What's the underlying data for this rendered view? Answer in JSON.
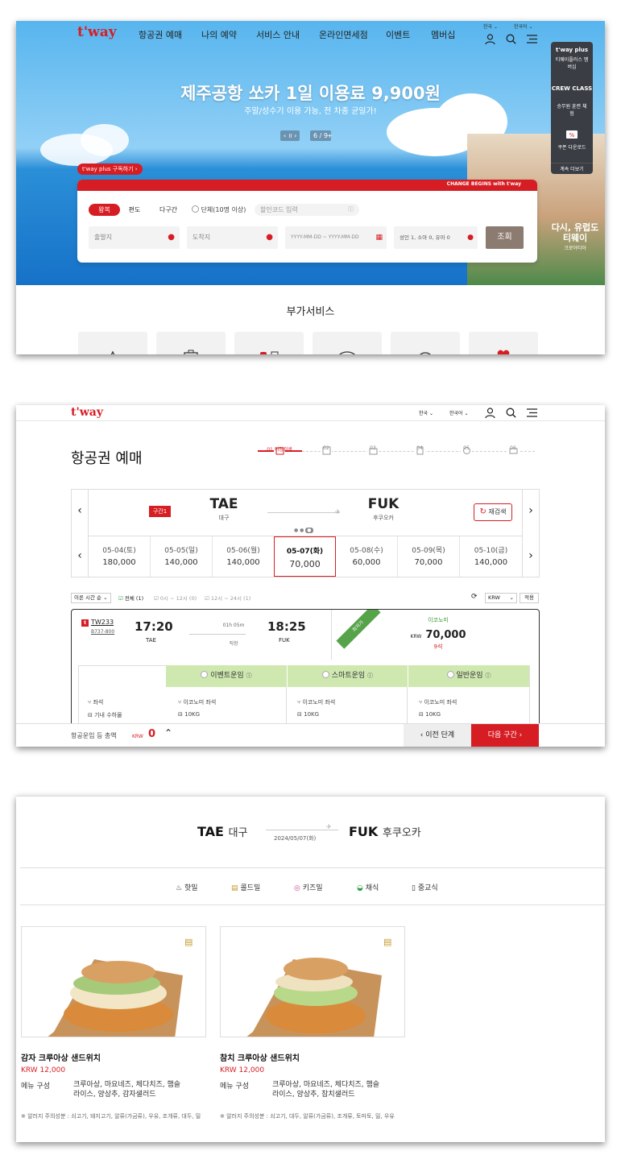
{
  "screen1": {
    "logo": "t'way",
    "nav": [
      "항공권 예매",
      "나의 예약",
      "서비스 안내",
      "온라인면세점",
      "이벤트",
      "멤버십"
    ],
    "lang": [
      "한국",
      "한국어"
    ],
    "banner": {
      "title": "제주공항 쏘카 1일 이용료 9,900원",
      "subtitle": "주말/성수기 이용 가능, 전 차종 균일가!",
      "page": "6 / 9",
      "town_text": [
        "다시, 유럽도 티웨이",
        "크로아티아"
      ]
    },
    "side_menu": [
      "t'way plus",
      "티웨이플러스 멤버십",
      "CREW CLASS",
      "승무원 훈련 체험",
      "쿠폰 다운로드",
      "계속 더보기"
    ],
    "subscribe_tag": "t'way plus 구독하기",
    "panel_slogan": "CHANGE BEGINS with t'way",
    "trip_types": [
      "왕복",
      "편도",
      "다구간"
    ],
    "group_label": "단체(10명 이상)",
    "promo_placeholder": "할인코드 입력",
    "origin_placeholder": "출발지",
    "dest_placeholder": "도착지",
    "date_placeholder": "YYYY-MM-DD  ~  YYYY-MM-DD",
    "pax": "성인 1, 소아 0, 유아 0",
    "search_btn": "조회",
    "section_title": "부가서비스",
    "colors": {
      "brand": "#d71d24",
      "sky": "#57b5ee",
      "sea": "#1672c8"
    }
  },
  "screen2": {
    "logo": "t'way",
    "lang": [
      "한국",
      "한국어"
    ],
    "page_title": "항공권 예매",
    "steps": [
      "01 여정검색",
      "02",
      "03",
      "04",
      "05",
      "06"
    ],
    "segment_badge": "구간1",
    "origin": {
      "code": "TAE",
      "city": "대구"
    },
    "dest": {
      "code": "FUK",
      "city": "후쿠오카"
    },
    "research_btn": "재검색",
    "dates": [
      {
        "date": "05-04(토)",
        "price": "180,000"
      },
      {
        "date": "05-05(일)",
        "price": "140,000"
      },
      {
        "date": "05-06(월)",
        "price": "140,000"
      },
      {
        "date": "05-07(화)",
        "price": "70,000",
        "selected": true
      },
      {
        "date": "05-08(수)",
        "price": "60,000"
      },
      {
        "date": "05-09(목)",
        "price": "70,000"
      },
      {
        "date": "05-10(금)",
        "price": "140,000"
      }
    ],
    "sort": "이른 시간 순",
    "filters": [
      "전체 (1)",
      "0시 ~ 12시 (0)",
      "12시 ~ 24시 (1)"
    ],
    "currency": "KRW",
    "apply_btn": "적용",
    "flight": {
      "no": "TW233",
      "aircraft": "B737-800",
      "dep_time": "17:20",
      "dep_code": "TAE",
      "duration": "01h 05m",
      "type": "직항",
      "arr_time": "18:25",
      "arr_code": "FUK",
      "ribbon": "최저가",
      "cabin": "이코노미",
      "currency": "KRW",
      "price": "70,000",
      "seats": "9석"
    },
    "fares": [
      "이벤트운임",
      "스마트운임",
      "일반운임"
    ],
    "fare_rows": {
      "labels": [
        "좌석",
        "기내 수하물"
      ],
      "seat": "이코노미 좌석",
      "bag": "10KG"
    },
    "total_label": "항공운임 등 총액",
    "total_currency": "KRW",
    "total": "0",
    "prev_btn": "이전 단계",
    "next_btn": "다음 구간"
  },
  "screen3": {
    "origin": {
      "code": "TAE",
      "city": "대구"
    },
    "dest": {
      "code": "FUK",
      "city": "후쿠오카"
    },
    "date": "2024/05/07(화)",
    "meal_tabs": [
      "핫밀",
      "콜드밀",
      "키즈밀",
      "채식",
      "중교식"
    ],
    "menus": [
      {
        "name": "감자 크루아상 샌드위치",
        "price": "KRW 12,000",
        "label": "메뉴 구성",
        "composition": "크루아상, 마요네즈, 체다치즈, 햄슬라이스, 양상추, 감자샐러드",
        "allergy": "※ 알러지 주의성분 : 쇠고기, 돼지고기, 알류(가금류), 우유, 조개류, 대두, 밀"
      },
      {
        "name": "참치 크루아상 샌드위치",
        "price": "KRW 12,000",
        "label": "메뉴 구성",
        "composition": "크루아상, 마요네즈, 체다치즈, 햄슬라이스, 양상추, 참치샐러드",
        "allergy": "※ 알러지 주의성분 : 쇠고기, 대두, 알류(가금류), 조개류, 토마토, 밀, 우유"
      }
    ]
  }
}
